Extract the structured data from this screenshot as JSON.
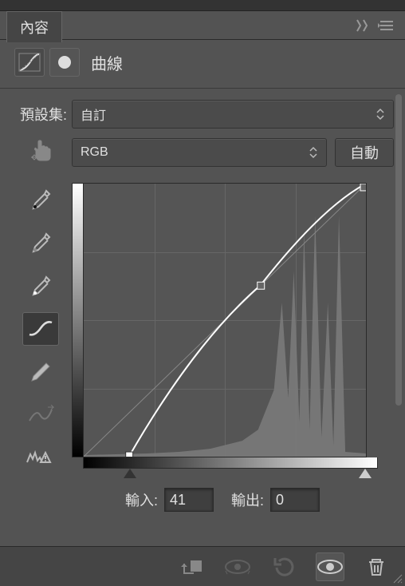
{
  "panel": {
    "tab_title": "內容",
    "adjustment_label": "曲線"
  },
  "preset": {
    "label": "預設集:",
    "value": "自訂"
  },
  "channel": {
    "value": "RGB",
    "auto_label": "自動"
  },
  "io": {
    "input_label": "輸入:",
    "input_value": "41",
    "output_label": "輸出:",
    "output_value": "0"
  },
  "chart_data": {
    "type": "line",
    "title": "曲線",
    "xlim": [
      0,
      255
    ],
    "ylim": [
      0,
      255
    ],
    "xlabel": "輸入",
    "ylabel": "輸出",
    "curve_points": [
      {
        "x": 41,
        "y": 0
      },
      {
        "x": 160,
        "y": 160
      },
      {
        "x": 255,
        "y": 255
      }
    ],
    "sliders": {
      "black": 41,
      "white": 255
    },
    "histogram_hint": "background histogram concentrated in highlights ~180-255 with tall spikes"
  }
}
